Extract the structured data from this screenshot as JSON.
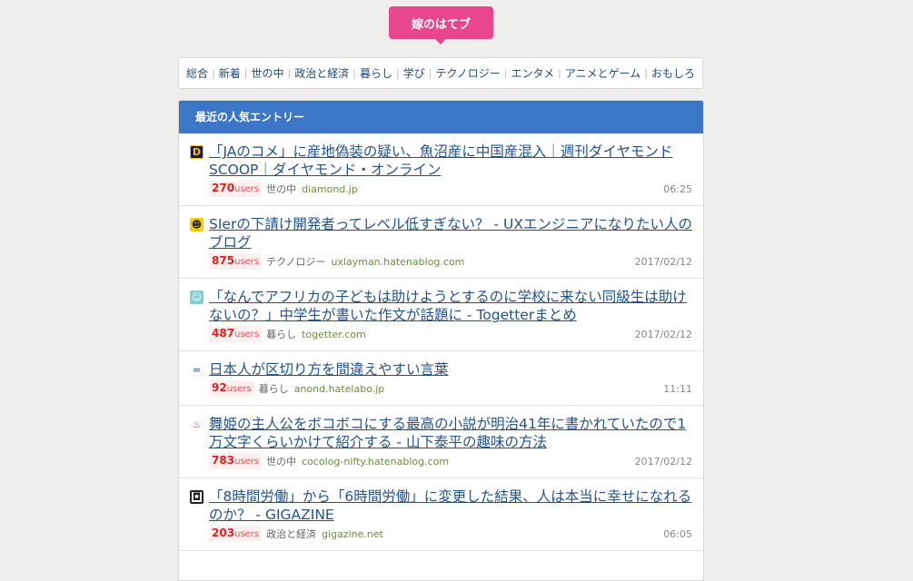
{
  "header": {
    "logo_text": "嫁のはてブ"
  },
  "nav": {
    "categories": [
      "総合",
      "新着",
      "世の中",
      "政治と経済",
      "暮らし",
      "学び",
      "テクノロジー",
      "エンタメ",
      "アニメとゲーム",
      "おもしろ"
    ]
  },
  "panel": {
    "title": "最近の人気エントリー"
  },
  "entries": [
    {
      "title": "「JAのコメ」に産地偽装の疑い、魚沼産に中国産混入｜週刊ダイヤモンドSCOOP｜ダイヤモンド・オンライン",
      "users": "270",
      "users_unit": "users",
      "category": "世の中",
      "domain": "diamond.jp",
      "time": "06:25",
      "favicon": "D"
    },
    {
      "title": "SIerの下請け開発者ってレベル低すぎない？ - UXエンジニアになりたい人のブログ",
      "users": "875",
      "users_unit": "users",
      "category": "テクノロジー",
      "domain": "uxlayman.hatenablog.com",
      "time": "2017/02/12",
      "favicon": "☻"
    },
    {
      "title": "「なんでアフリカの子どもは助けようとするのに学校に来ない同級生は助けないの？」中学生が書いた作文が話題に - Togetterまとめ",
      "users": "487",
      "users_unit": "users",
      "category": "暮らし",
      "domain": "togetter.com",
      "time": "2017/02/12",
      "favicon": "☺"
    },
    {
      "title": "日本人が区切り方を間違えやすい言葉",
      "users": "92",
      "users_unit": "users",
      "category": "暮らし",
      "domain": "anond.hatelabo.jp",
      "time": "11:11",
      "favicon": "≈"
    },
    {
      "title": "舞姫の主人公をボコボコにする最高の小説が明治41年に書かれていたので1万文字くらいかけて紹介する - 山下泰平の趣味の方法",
      "users": "783",
      "users_unit": "users",
      "category": "世の中",
      "domain": "cocolog-nifty.hatenablog.com",
      "time": "2017/02/12",
      "favicon": "♨"
    },
    {
      "title": "「8時間労働」から「6時間労働」に変更した結果、人は本当に幸せになれるのか？ - GIGAZINE",
      "users": "203",
      "users_unit": "users",
      "category": "政治と経済",
      "domain": "gigazine.net",
      "time": "06:05",
      "favicon": "◘"
    }
  ],
  "colors": {
    "brand": "#e8488b",
    "panel_head": "#3c76c7",
    "link": "#24528a",
    "users": "#e02020"
  }
}
